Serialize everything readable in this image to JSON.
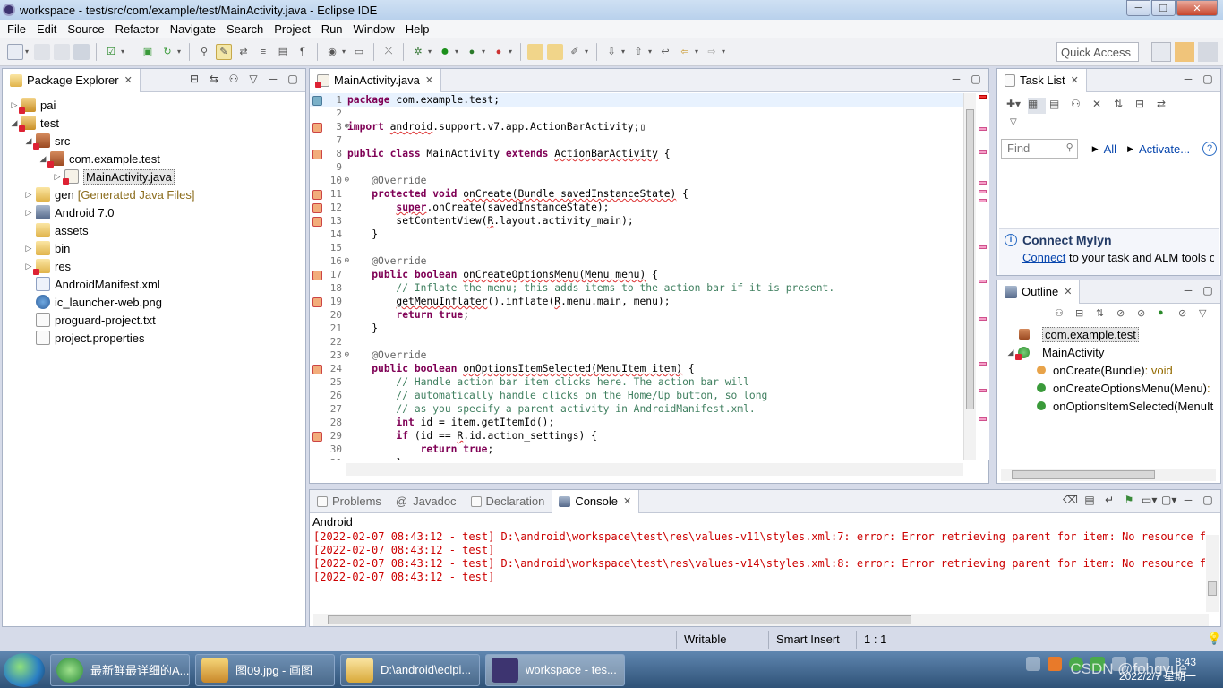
{
  "window": {
    "title": "workspace - test/src/com/example/test/MainActivity.java - Eclipse IDE",
    "buttons": [
      "─",
      "❐",
      "✕"
    ]
  },
  "menu": [
    "File",
    "Edit",
    "Source",
    "Refactor",
    "Navigate",
    "Search",
    "Project",
    "Run",
    "Window",
    "Help"
  ],
  "toolbar": {
    "quick_access": "Quick Access"
  },
  "package_explorer": {
    "title": "Package Explorer",
    "items": [
      {
        "label": "pai",
        "depth": 0,
        "twisty": "▷",
        "icon": "project-icon"
      },
      {
        "label": "test",
        "depth": 0,
        "twisty": "◢",
        "icon": "project-icon"
      },
      {
        "label": "src",
        "depth": 1,
        "twisty": "◢",
        "icon": "source-folder-icon"
      },
      {
        "label": "com.example.test",
        "depth": 2,
        "twisty": "◢",
        "icon": "package-icon"
      },
      {
        "label": "MainActivity.java",
        "depth": 3,
        "twisty": "▷",
        "icon": "java-file-icon",
        "selected": true
      },
      {
        "label": "gen",
        "hint": "[Generated Java Files]",
        "depth": 1,
        "twisty": "▷",
        "icon": "folder-icon"
      },
      {
        "label": "Android 7.0",
        "depth": 1,
        "twisty": "▷",
        "icon": "library-icon"
      },
      {
        "label": "assets",
        "depth": 1,
        "twisty": "",
        "icon": "folder-icon"
      },
      {
        "label": "bin",
        "depth": 1,
        "twisty": "▷",
        "icon": "folder-icon"
      },
      {
        "label": "res",
        "depth": 1,
        "twisty": "▷",
        "icon": "folder-icon"
      },
      {
        "label": "AndroidManifest.xml",
        "depth": 1,
        "twisty": "",
        "icon": "xml-file-icon"
      },
      {
        "label": "ic_launcher-web.png",
        "depth": 1,
        "twisty": "",
        "icon": "image-file-icon"
      },
      {
        "label": "proguard-project.txt",
        "depth": 1,
        "twisty": "",
        "icon": "text-file-icon"
      },
      {
        "label": "project.properties",
        "depth": 1,
        "twisty": "",
        "icon": "text-file-icon"
      }
    ]
  },
  "editor": {
    "tab": "MainActivity.java",
    "lines": [
      {
        "n": "1",
        "html": "<span class=\"kw\">package</span> com.example.test;"
      },
      {
        "n": "2",
        "html": ""
      },
      {
        "n": "3",
        "fold": "⊕",
        "err": true,
        "html": "<span class=\"kw\">import</span> <span class=\"sq\">android</span>.support.v7.app.ActionBarActivity;▯"
      },
      {
        "n": "7",
        "html": ""
      },
      {
        "n": "8",
        "err": true,
        "html": "<span class=\"kw\">public class</span> MainActivity <span class=\"kw\">extends</span> <span class=\"sq\">ActionBarActivity</span> {"
      },
      {
        "n": "9",
        "html": ""
      },
      {
        "n": "10",
        "fold": "⊖",
        "html": "    <span class=\"an\">@Override</span>"
      },
      {
        "n": "11",
        "err": true,
        "html": "    <span class=\"kw\">protected void</span> <span class=\"sq\">onCreate(Bundle savedInstanceState)</span> {"
      },
      {
        "n": "12",
        "err": true,
        "html": "        <span class=\"kw sq\">super</span>.onCreate(savedInstanceState);"
      },
      {
        "n": "13",
        "err": true,
        "html": "        setContentView(<span class=\"sq\">R</span>.layout.activity_main);"
      },
      {
        "n": "14",
        "html": "    }"
      },
      {
        "n": "15",
        "html": ""
      },
      {
        "n": "16",
        "fold": "⊖",
        "html": "    <span class=\"an\">@Override</span>"
      },
      {
        "n": "17",
        "err": true,
        "html": "    <span class=\"kw\">public boolean</span> <span class=\"sq\">onCreateOptionsMenu(Menu menu)</span> {"
      },
      {
        "n": "18",
        "html": "        <span class=\"cm\">// Inflate the menu; this adds items to the action bar if it is present.</span>"
      },
      {
        "n": "19",
        "err": true,
        "html": "        <span class=\"sq\">getMenuInflater</span>().inflate(<span class=\"sq\">R</span>.menu.main, menu);"
      },
      {
        "n": "20",
        "html": "        <span class=\"kw\">return true</span>;"
      },
      {
        "n": "21",
        "html": "    }"
      },
      {
        "n": "22",
        "html": ""
      },
      {
        "n": "23",
        "fold": "⊖",
        "html": "    <span class=\"an\">@Override</span>"
      },
      {
        "n": "24",
        "err": true,
        "html": "    <span class=\"kw\">public boolean</span> <span class=\"sq\">onOptionsItemSelected(MenuItem item)</span> {"
      },
      {
        "n": "25",
        "html": "        <span class=\"cm\">// Handle action bar item clicks here. The action bar will</span>"
      },
      {
        "n": "26",
        "html": "        <span class=\"cm\">// automatically handle clicks on the Home/Up button, so long</span>"
      },
      {
        "n": "27",
        "html": "        <span class=\"cm\">// as you specify a parent activity in AndroidManifest.xml.</span>"
      },
      {
        "n": "28",
        "html": "        <span class=\"kw\">int</span> id = item.getItemId();"
      },
      {
        "n": "29",
        "err": true,
        "html": "        <span class=\"kw\">if</span> (id == <span class=\"sq\">R</span>.id.action_settings) {"
      },
      {
        "n": "30",
        "html": "            <span class=\"kw\">return true</span>;"
      },
      {
        "n": "31",
        "html": "        }"
      }
    ]
  },
  "task_list": {
    "title": "Task List",
    "find_placeholder": "Find",
    "all_link": "All",
    "activate_link": "Activate...",
    "mylyn_title": "Connect Mylyn",
    "mylyn_link": "Connect",
    "mylyn_text": " to your task and ALM tools o"
  },
  "outline": {
    "title": "Outline",
    "package": "com.example.test",
    "class": "MainActivity",
    "methods": [
      {
        "name": "onCreate(Bundle)",
        "type": " : void"
      },
      {
        "name": "onCreateOptionsMenu(Menu)",
        "type": " :"
      },
      {
        "name": "onOptionsItemSelected(MenuIt",
        "type": ""
      }
    ]
  },
  "bottom_tabs": {
    "problems": "Problems",
    "javadoc": "Javadoc",
    "declaration": "Declaration",
    "console": "Console"
  },
  "console": {
    "label": "Android",
    "lines": [
      "[2022-02-07 08:43:12 - test] D:\\android\\workspace\\test\\res\\values-v11\\styles.xml:7: error: Error retrieving parent for item: No resource found",
      "[2022-02-07 08:43:12 - test]",
      "[2022-02-07 08:43:12 - test] D:\\android\\workspace\\test\\res\\values-v14\\styles.xml:8: error: Error retrieving parent for item: No resource found",
      "[2022-02-07 08:43:12 - test]"
    ]
  },
  "status": {
    "writable": "Writable",
    "insert": "Smart Insert",
    "position": "1 : 1"
  },
  "taskbar": {
    "items": [
      "最新鲜最详细的A...",
      "图09.jpg - 画图",
      "D:\\android\\eclpi...",
      "workspace - tes..."
    ],
    "time": "8:43",
    "date": "2022/2/7 星期一",
    "watermark": "CSDN @fohgyue"
  }
}
